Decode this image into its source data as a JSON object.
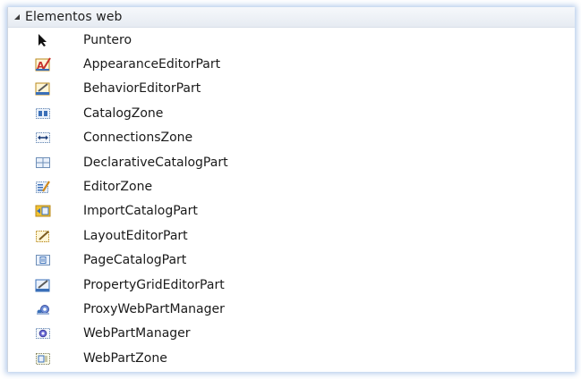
{
  "toolbox": {
    "group_title": "Elementos web",
    "group_expanded": true,
    "items": [
      {
        "label": "Puntero",
        "icon": "pointer-icon"
      },
      {
        "label": "AppearanceEditorPart",
        "icon": "appearance-editor-part-icon"
      },
      {
        "label": "BehaviorEditorPart",
        "icon": "behavior-editor-part-icon"
      },
      {
        "label": "CatalogZone",
        "icon": "catalog-zone-icon"
      },
      {
        "label": "ConnectionsZone",
        "icon": "connections-zone-icon"
      },
      {
        "label": "DeclarativeCatalogPart",
        "icon": "declarative-catalog-part-icon"
      },
      {
        "label": "EditorZone",
        "icon": "editor-zone-icon"
      },
      {
        "label": "ImportCatalogPart",
        "icon": "import-catalog-part-icon"
      },
      {
        "label": "LayoutEditorPart",
        "icon": "layout-editor-part-icon"
      },
      {
        "label": "PageCatalogPart",
        "icon": "page-catalog-part-icon"
      },
      {
        "label": "PropertyGridEditorPart",
        "icon": "property-grid-editor-part-icon"
      },
      {
        "label": "ProxyWebPartManager",
        "icon": "proxy-web-part-manager-icon"
      },
      {
        "label": "WebPartManager",
        "icon": "web-part-manager-icon"
      },
      {
        "label": "WebPartZone",
        "icon": "web-part-zone-icon"
      }
    ]
  },
  "colors": {
    "glow": "#5a8cd2",
    "header_top": "#f6f8fb",
    "header_bottom": "#e6ebf2",
    "icon_blue": "#3a6fb8",
    "icon_yellow": "#f2c230",
    "icon_red": "#c8322a"
  }
}
